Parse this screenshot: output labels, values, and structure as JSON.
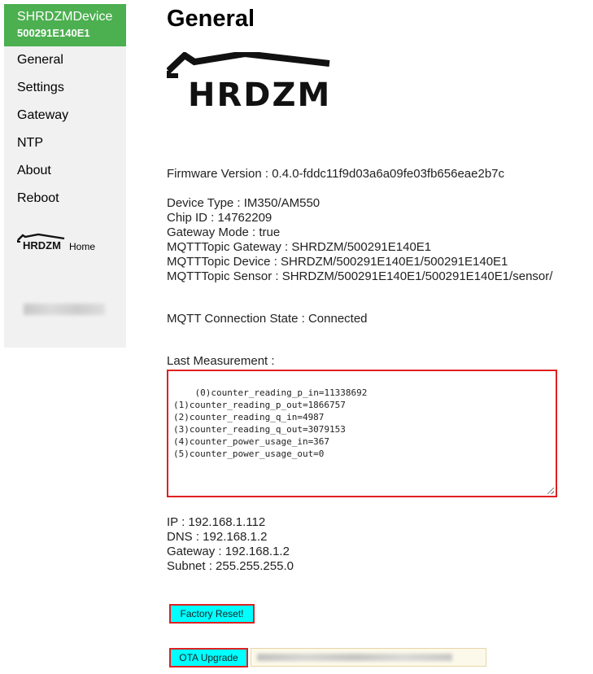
{
  "sidebar": {
    "device_name": "SHRDZMDevice",
    "device_id": "500291E140E1",
    "items": [
      {
        "label": "General"
      },
      {
        "label": "Settings"
      },
      {
        "label": "Gateway"
      },
      {
        "label": "NTP"
      },
      {
        "label": "About"
      },
      {
        "label": "Reboot"
      }
    ],
    "home_logo_text": "HRDZM",
    "home_label": "Home"
  },
  "main": {
    "title": "General",
    "logo_text": "HRDZM",
    "firmware": "Firmware Version : 0.4.0-fddc11f9d03a6a09fe03fb656eae2b7c",
    "device_info": [
      "Device Type : IM350/AM550",
      "Chip ID : 14762209",
      "Gateway Mode : true",
      "MQTTTopic Gateway : SHRDZM/500291E140E1",
      "MQTTTopic Device : SHRDZM/500291E140E1/500291E140E1",
      "MQTTTopic Sensor : SHRDZM/500291E140E1/500291E140E1/sensor/"
    ],
    "mqtt_state": "MQTT Connection State : Connected",
    "last_measurement_label": "Last Measurement :",
    "measurements": "(0)counter_reading_p_in=11338692\n(1)counter_reading_p_out=1866757\n(2)counter_reading_q_in=4987\n(3)counter_reading_q_out=3079153\n(4)counter_power_usage_in=367\n(5)counter_power_usage_out=0",
    "network": [
      "IP : 192.168.1.112",
      "DNS : 192.168.1.2",
      "Gateway : 192.168.1.2",
      "Subnet : 255.255.255.0"
    ],
    "factory_reset_label": "Factory Reset!",
    "ota_upgrade_label": "OTA Upgrade"
  },
  "colors": {
    "header_green": "#4caf50",
    "sidebar_bg": "#f1f1f1",
    "button_cyan": "#00ffff",
    "border_red": "#e02020"
  }
}
